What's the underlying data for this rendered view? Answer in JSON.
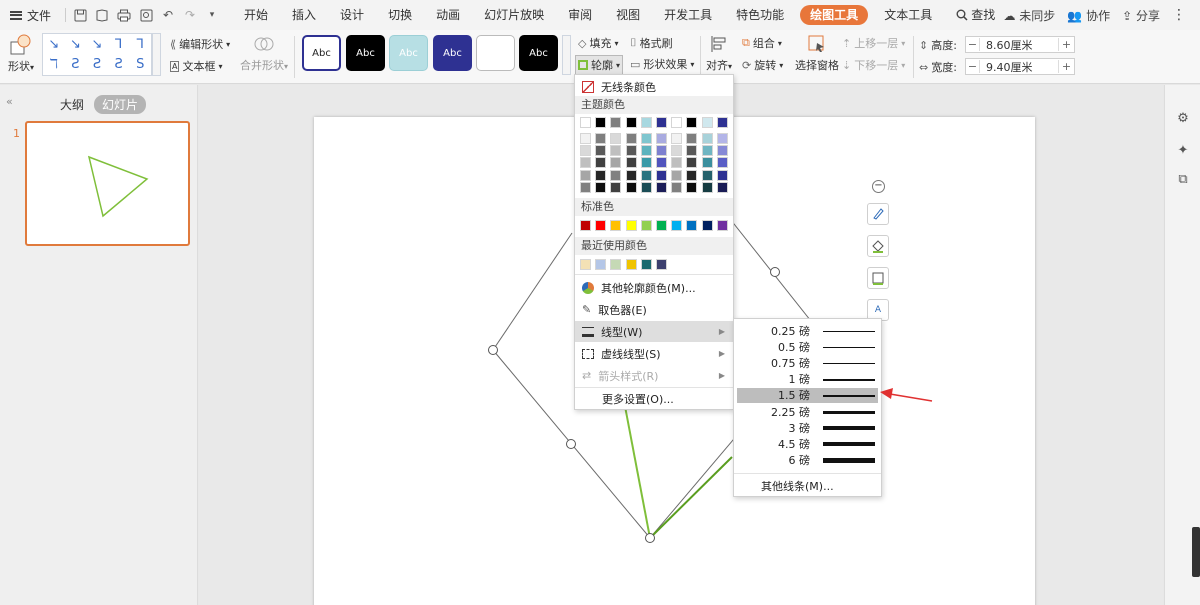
{
  "menubar": {
    "file_label": "文件",
    "tabs": [
      "开始",
      "插入",
      "设计",
      "切换",
      "动画",
      "幻灯片放映",
      "审阅",
      "视图",
      "开发工具",
      "特色功能",
      "绘图工具",
      "文本工具"
    ],
    "active_tab": "绘图工具",
    "search_label": "查找",
    "unsynced_label": "未同步",
    "collab_label": "协作",
    "share_label": "分享"
  },
  "ribbon": {
    "shape_label": "形状",
    "edit_shape_label": "编辑形状",
    "textbox_label": "文本框",
    "merge_shape_label": "合并形状",
    "style_samples": [
      "Abc",
      "Abc",
      "Abc",
      "Abc",
      "",
      "Abc"
    ],
    "fill_label": "填充",
    "format_brush_label": "格式刷",
    "outline_label": "轮廓",
    "shape_effect_label": "形状效果",
    "align_label": "对齐",
    "group_label": "组合",
    "rotate_label": "旋转",
    "selection_pane_label": "选择窗格",
    "bring_forward_label": "上移一层",
    "send_backward_label": "下移一层",
    "height_label": "高度:",
    "height_value": "8.60厘米",
    "width_label": "宽度:",
    "width_value": "9.40厘米"
  },
  "left_panel": {
    "outline_tab": "大纲",
    "slides_tab": "幻灯片",
    "slide_number": "1"
  },
  "outline_menu": {
    "no_line": "无线条颜色",
    "theme_colors_title": "主题颜色",
    "standard_colors_title": "标准色",
    "recent_colors_title": "最近使用颜色",
    "more_colors": "其他轮廓颜色(M)...",
    "eyedropper": "取色器(E)",
    "line_type": "线型(W)",
    "dash_type": "虚线线型(S)",
    "arrow_style": "箭头样式(R)",
    "more_settings": "更多设置(O)...",
    "theme_top_row": [
      "#ffffff",
      "#000000",
      "#7f7f7f",
      "#000000",
      "#a8d8e0",
      "#2e3192",
      "#ffffff",
      "#000000",
      "#d0e8ee",
      "#2e3192"
    ],
    "theme_shade_columns": [
      [
        "#f2f2f2",
        "#d9d9d9",
        "#bfbfbf",
        "#a6a6a6",
        "#808080"
      ],
      [
        "#7f7f7f",
        "#595959",
        "#404040",
        "#262626",
        "#0d0d0d"
      ],
      [
        "#d9d9d9",
        "#bfbfbf",
        "#a6a6a6",
        "#808080",
        "#404040"
      ],
      [
        "#7f7f7f",
        "#595959",
        "#404040",
        "#262626",
        "#0d0d0d"
      ],
      [
        "#7fc6cf",
        "#5db3be",
        "#3a9aa8",
        "#2a7380",
        "#1b4d56"
      ],
      [
        "#a9abe0",
        "#7d80cf",
        "#5154bd",
        "#2e3192",
        "#1c1e59"
      ],
      [
        "#f2f2f2",
        "#d9d9d9",
        "#bfbfbf",
        "#a6a6a6",
        "#808080"
      ],
      [
        "#7f7f7f",
        "#595959",
        "#404040",
        "#262626",
        "#0d0d0d"
      ],
      [
        "#a8d2da",
        "#6fb5c2",
        "#3b8f9e",
        "#25616b",
        "#163c42"
      ],
      [
        "#b3b5e8",
        "#8689d6",
        "#5a5ec6",
        "#2e3192",
        "#1a1c56"
      ]
    ],
    "standard_colors": [
      "#c00000",
      "#ff0000",
      "#ffc000",
      "#ffff00",
      "#92d050",
      "#00b050",
      "#00b0f0",
      "#0070c0",
      "#002060",
      "#7030a0"
    ],
    "recent_colors": [
      "#f3e1b5",
      "#b4c6e7",
      "#c5d9b5",
      "#f0c400",
      "#1a6a6e",
      "#3c3f6e"
    ]
  },
  "line_weight_menu": {
    "options": [
      {
        "label": "0.25 磅",
        "weight": 0.5
      },
      {
        "label": "0.5 磅",
        "weight": 1
      },
      {
        "label": "0.75 磅",
        "weight": 1.2
      },
      {
        "label": "1 磅",
        "weight": 1.5
      },
      {
        "label": "1.5 磅",
        "weight": 2
      },
      {
        "label": "2.25 磅",
        "weight": 3
      },
      {
        "label": "3 磅",
        "weight": 3.5
      },
      {
        "label": "4.5 磅",
        "weight": 4.5
      },
      {
        "label": "6 磅",
        "weight": 5.5
      }
    ],
    "selected": "1.5 磅",
    "more_lines": "其他线条(M)..."
  },
  "colors": {
    "accent": "#e8763a",
    "shape_stroke": "#7fbf3a",
    "annotation_arrow": "#e03131"
  }
}
